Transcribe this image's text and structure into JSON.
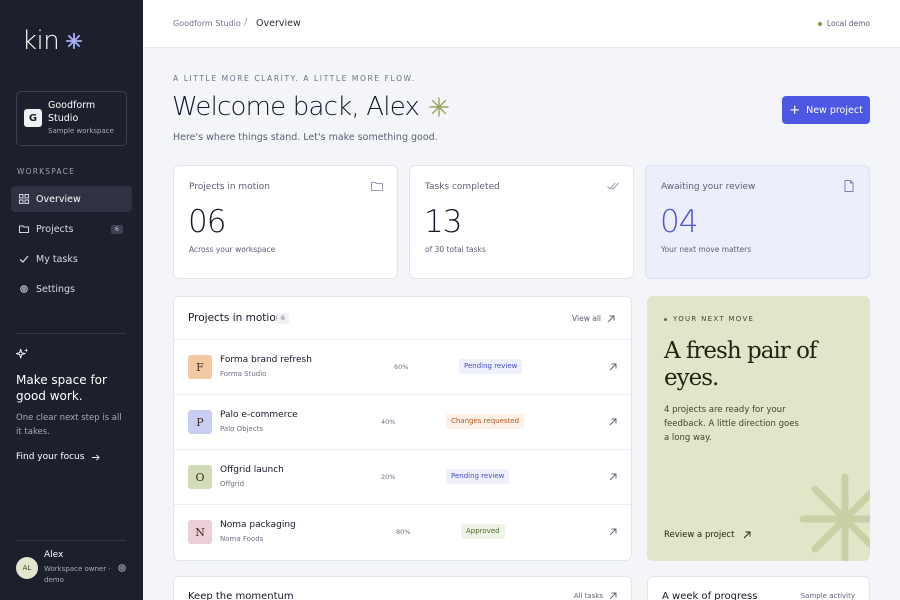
{
  "brand": {
    "name": "kin"
  },
  "workspace": {
    "initial": "G",
    "name": "Goodform Studio",
    "sub": "Sample workspace"
  },
  "sidebar": {
    "section_label": "WORKSPACE",
    "items": [
      {
        "label": "Overview",
        "icon": "grid-icon",
        "active": true
      },
      {
        "label": "Projects",
        "icon": "folder-icon",
        "badge": "6"
      },
      {
        "label": "My tasks",
        "icon": "check-icon"
      },
      {
        "label": "Settings",
        "icon": "gear-icon"
      }
    ],
    "promo": {
      "title": "Make space for good work.",
      "text": "One clear next step is all it takes.",
      "link": "Find your focus"
    },
    "user": {
      "initials": "AL",
      "name": "Alex",
      "role": "Workspace owner · demo"
    }
  },
  "topbar": {
    "breadcrumb_parent": "Goodform Studio",
    "breadcrumb_sep": "/",
    "breadcrumb_current": "Overview",
    "status": "Local demo"
  },
  "header": {
    "eyebrow": "A LITTLE MORE CLARITY. A LITTLE MORE FLOW.",
    "title": "Welcome back, Alex",
    "subtitle": "Here's where things stand. Let's make something good.",
    "new_button": "New project"
  },
  "stats": [
    {
      "label": "Projects in motion",
      "value": "06",
      "sub": "Across your workspace",
      "icon": "folder-icon"
    },
    {
      "label": "Tasks completed",
      "value": "13",
      "sub": "of 30 total tasks",
      "icon": "double-check-icon"
    },
    {
      "label": "Awaiting your review",
      "value": "04",
      "sub": "Your next move matters",
      "icon": "document-icon"
    }
  ],
  "projects": {
    "title": "Projects in motion",
    "count": "6",
    "view_all": "View all",
    "rows": [
      {
        "initial": "F",
        "name": "Forma brand refresh",
        "client": "Forma Studio",
        "progress": "60%",
        "status": "Pending review",
        "status_kind": "pending",
        "color": "#f2c9a3"
      },
      {
        "initial": "P",
        "name": "Palo e-commerce",
        "client": "Palo Objects",
        "progress": "40%",
        "status": "Changes requested",
        "status_kind": "changes",
        "color": "#c9cdf3"
      },
      {
        "initial": "O",
        "name": "Offgrid launch",
        "client": "Offgrid",
        "progress": "20%",
        "status": "Pending review",
        "status_kind": "pending",
        "color": "#d3dcb9"
      },
      {
        "initial": "N",
        "name": "Noma packaging",
        "client": "Noma Foods",
        "progress": "80%",
        "status": "Approved",
        "status_kind": "approved",
        "color": "#edcfd8"
      }
    ]
  },
  "next_move": {
    "eyebrow": "YOUR NEXT MOVE",
    "title": "A fresh pair of eyes.",
    "text": "4 projects are ready for your feedback. A little direction goes a long way.",
    "link": "Review a project"
  },
  "bottom": {
    "left_title": "Keep the momentum",
    "left_link": "All tasks",
    "right_title": "A week of progress",
    "right_note": "Sample activity"
  },
  "colors": {
    "accent": "#4d57e3",
    "sidebar": "#1c1f2c",
    "next_move_bg": "#e1e6c9",
    "review_bg": "#eceefc"
  }
}
